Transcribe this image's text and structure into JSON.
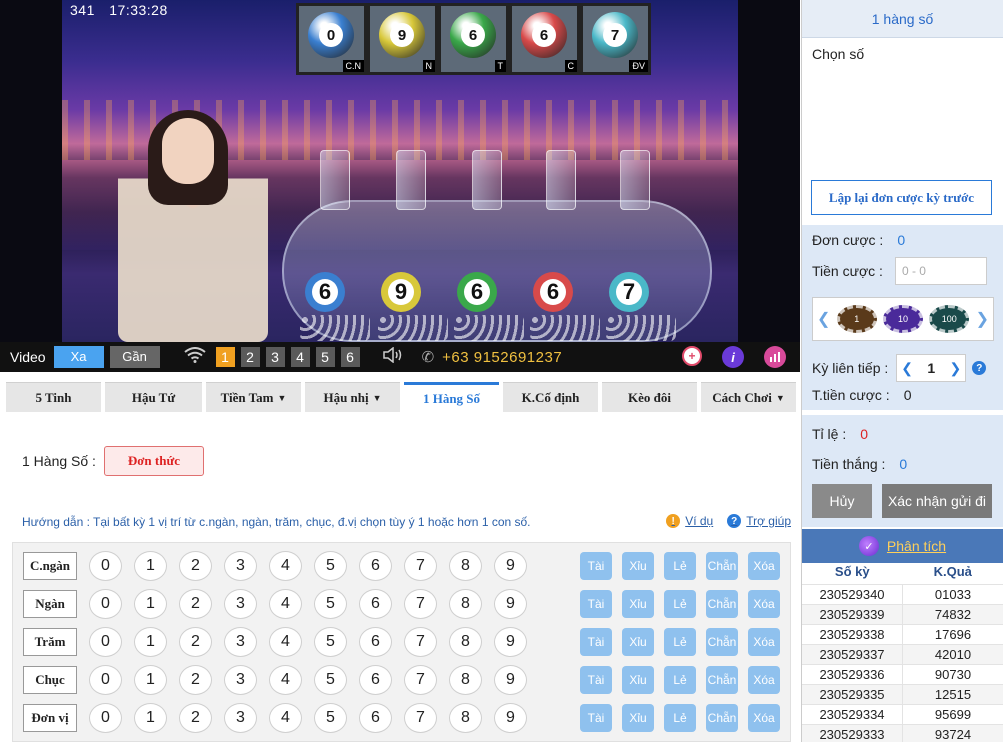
{
  "video": {
    "counter": "341",
    "clock": "17:33:28",
    "top_balls": [
      {
        "digit": "0",
        "tag": "C.N",
        "color": "#3a7fd0"
      },
      {
        "digit": "9",
        "tag": "N",
        "color": "#d8c83a"
      },
      {
        "digit": "6",
        "tag": "T",
        "color": "#3aa84a"
      },
      {
        "digit": "6",
        "tag": "C",
        "color": "#d84a4a"
      },
      {
        "digit": "7",
        "tag": "ĐV",
        "color": "#4ab8c8"
      }
    ],
    "machine_balls": [
      {
        "digit": "6",
        "color": "#3a7fd0"
      },
      {
        "digit": "9",
        "color": "#d8c83a"
      },
      {
        "digit": "6",
        "color": "#3aa84a"
      },
      {
        "digit": "6",
        "color": "#d84a4a"
      },
      {
        "digit": "7",
        "color": "#4ab8c8"
      }
    ],
    "controls": {
      "video_label": "Video",
      "far_label": "Xa",
      "near_label": "Gần",
      "channels": [
        "1",
        "2",
        "3",
        "4",
        "5",
        "6"
      ],
      "active_channel": "1",
      "phone": "+63 9152691237"
    }
  },
  "tabs": [
    {
      "label": "5 Tinh",
      "dropdown": false,
      "active": false
    },
    {
      "label": "Hậu Tứ",
      "dropdown": false,
      "active": false
    },
    {
      "label": "Tiền Tam",
      "dropdown": true,
      "active": false
    },
    {
      "label": "Hậu nhị",
      "dropdown": true,
      "active": false
    },
    {
      "label": "1 Hàng Số",
      "dropdown": false,
      "active": true
    },
    {
      "label": "K.Cố định",
      "dropdown": false,
      "active": false
    },
    {
      "label": "Kèo đôi",
      "dropdown": false,
      "active": false
    },
    {
      "label": "Cách Chơi",
      "dropdown": true,
      "active": false
    }
  ],
  "mode": {
    "label": "1 Hàng Số :",
    "button": "Đơn thức"
  },
  "guide": {
    "text": "Hướng dẫn : Tại bất kỳ 1 vị trí từ c.ngàn, ngàn, trăm, chục, đ.vị chọn tùy ý 1 hoặc hơn 1 con số.",
    "example": "Ví dụ",
    "help": "Trợ giúp"
  },
  "board": {
    "rows": [
      "C.ngàn",
      "Ngàn",
      "Trăm",
      "Chục",
      "Đơn vị"
    ],
    "numbers": [
      "0",
      "1",
      "2",
      "3",
      "4",
      "5",
      "6",
      "7",
      "8",
      "9"
    ],
    "quick": [
      "Tài",
      "Xỉu",
      "Lẻ",
      "Chẵn",
      "Xóa"
    ]
  },
  "sidebar": {
    "title": "1 hàng số",
    "pick_label": "Chọn số",
    "repeat": "Lập lại đơn cược kỳ trước",
    "bet_count_label": "Đơn cược :",
    "bet_count": "0",
    "bet_amount_label": "Tiền cược :",
    "bet_amount_placeholder": "0 - 0",
    "chips": [
      {
        "value": "1",
        "color": "#5a3a1a"
      },
      {
        "value": "10",
        "color": "#4a2a9a"
      },
      {
        "value": "100",
        "color": "#1a4a4a"
      }
    ],
    "consecutive_label": "Kỳ liên tiếp :",
    "consecutive": "1",
    "total_label": "T.tiền cược :",
    "total": "0",
    "odds_label": "Tỉ lệ :",
    "odds": "0",
    "win_label": "Tiền thắng :",
    "win": "0",
    "cancel": "Hủy",
    "confirm": "Xác nhận gửi đi",
    "analysis": "Phân tích",
    "history_head": [
      "Số kỳ",
      "K.Quả"
    ],
    "history": [
      [
        "230529340",
        "01033"
      ],
      [
        "230529339",
        "74832"
      ],
      [
        "230529338",
        "17696"
      ],
      [
        "230529337",
        "42010"
      ],
      [
        "230529336",
        "90730"
      ],
      [
        "230529335",
        "12515"
      ],
      [
        "230529334",
        "95699"
      ],
      [
        "230529333",
        "93724"
      ]
    ]
  }
}
